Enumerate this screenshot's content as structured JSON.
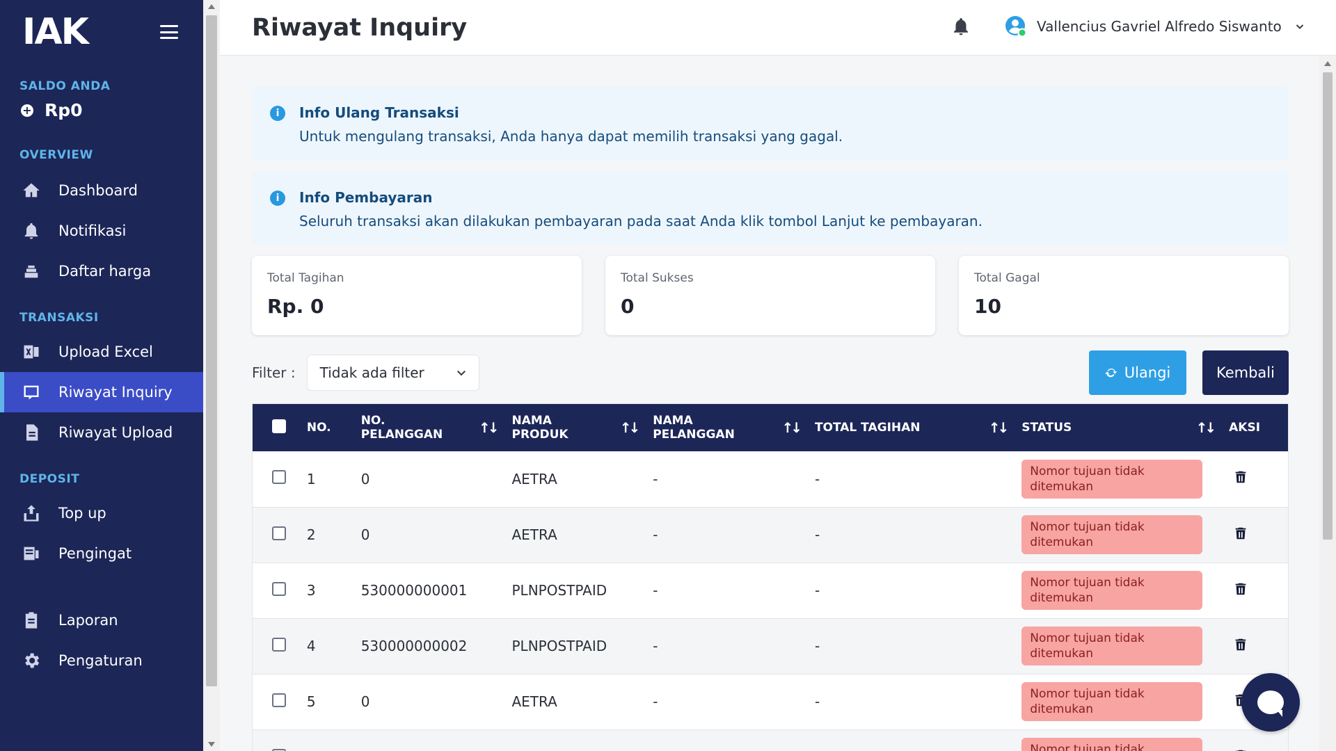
{
  "app": {
    "logo": "IAK"
  },
  "sidebar": {
    "saldo_label": "SALDO ANDA",
    "saldo_value": "Rp0",
    "sections": [
      {
        "label": "OVERVIEW",
        "items": [
          {
            "label": "Dashboard",
            "icon": "home-icon"
          },
          {
            "label": "Notifikasi",
            "icon": "bell-icon"
          },
          {
            "label": "Daftar harga",
            "icon": "price-list-icon"
          }
        ]
      },
      {
        "label": "TRANSAKSI",
        "items": [
          {
            "label": "Upload Excel",
            "icon": "excel-icon"
          },
          {
            "label": "Riwayat Inquiry",
            "icon": "inquiry-icon",
            "active": true
          },
          {
            "label": "Riwayat Upload",
            "icon": "document-icon"
          }
        ]
      },
      {
        "label": "DEPOSIT",
        "items": [
          {
            "label": "Top up",
            "icon": "topup-icon"
          },
          {
            "label": "Pengingat",
            "icon": "reminder-icon"
          },
          {
            "label": "Laporan",
            "icon": "report-icon"
          },
          {
            "label": "Pengaturan",
            "icon": "gear-icon"
          }
        ]
      }
    ]
  },
  "header": {
    "title": "Riwayat Inquiry",
    "user_name": "Vallencius Gavriel Alfredo Siswanto"
  },
  "info": [
    {
      "title": "Info Ulang Transaksi",
      "body": "Untuk mengulang transaksi, Anda hanya dapat memilih transaksi yang gagal."
    },
    {
      "title": "Info Pembayaran",
      "body": "Seluruh transaksi akan dilakukan pembayaran pada saat Anda klik tombol Lanjut ke pembayaran."
    }
  ],
  "stats": [
    {
      "label": "Total Tagihan",
      "value": "Rp. 0"
    },
    {
      "label": "Total Sukses",
      "value": "0"
    },
    {
      "label": "Total Gagal",
      "value": "10"
    }
  ],
  "filter": {
    "label": "Filter :",
    "value": "Tidak ada filter"
  },
  "buttons": {
    "ulangi": "Ulangi",
    "kembali": "Kembali"
  },
  "table": {
    "headers": [
      "NO.",
      "NO. PELANGGAN",
      "NAMA PRODUK",
      "NAMA PELANGGAN",
      "TOTAL TAGIHAN",
      "STATUS",
      "AKSI"
    ],
    "rows": [
      {
        "no": "1",
        "no_pelanggan": "0",
        "produk": "AETRA",
        "nama": "-",
        "total": "-",
        "status": "Nomor tujuan tidak ditemukan"
      },
      {
        "no": "2",
        "no_pelanggan": "0",
        "produk": "AETRA",
        "nama": "-",
        "total": "-",
        "status": "Nomor tujuan tidak ditemukan"
      },
      {
        "no": "3",
        "no_pelanggan": "530000000001",
        "produk": "PLNPOSTPAID",
        "nama": "-",
        "total": "-",
        "status": "Nomor tujuan tidak ditemukan"
      },
      {
        "no": "4",
        "no_pelanggan": "530000000002",
        "produk": "PLNPOSTPAID",
        "nama": "-",
        "total": "-",
        "status": "Nomor tujuan tidak ditemukan"
      },
      {
        "no": "5",
        "no_pelanggan": "0",
        "produk": "AETRA",
        "nama": "-",
        "total": "-",
        "status": "Nomor tujuan tidak ditemukan"
      },
      {
        "no": "",
        "no_pelanggan": "",
        "produk": "",
        "nama": "",
        "total": "",
        "status": "Nomor tujuan tidak ditemukan"
      }
    ]
  },
  "colors": {
    "sidebar_bg": "#1c2657",
    "active_item": "#3a4cc6",
    "accent": "#2e9fe4",
    "status_error_bg": "#f7a4a2"
  }
}
